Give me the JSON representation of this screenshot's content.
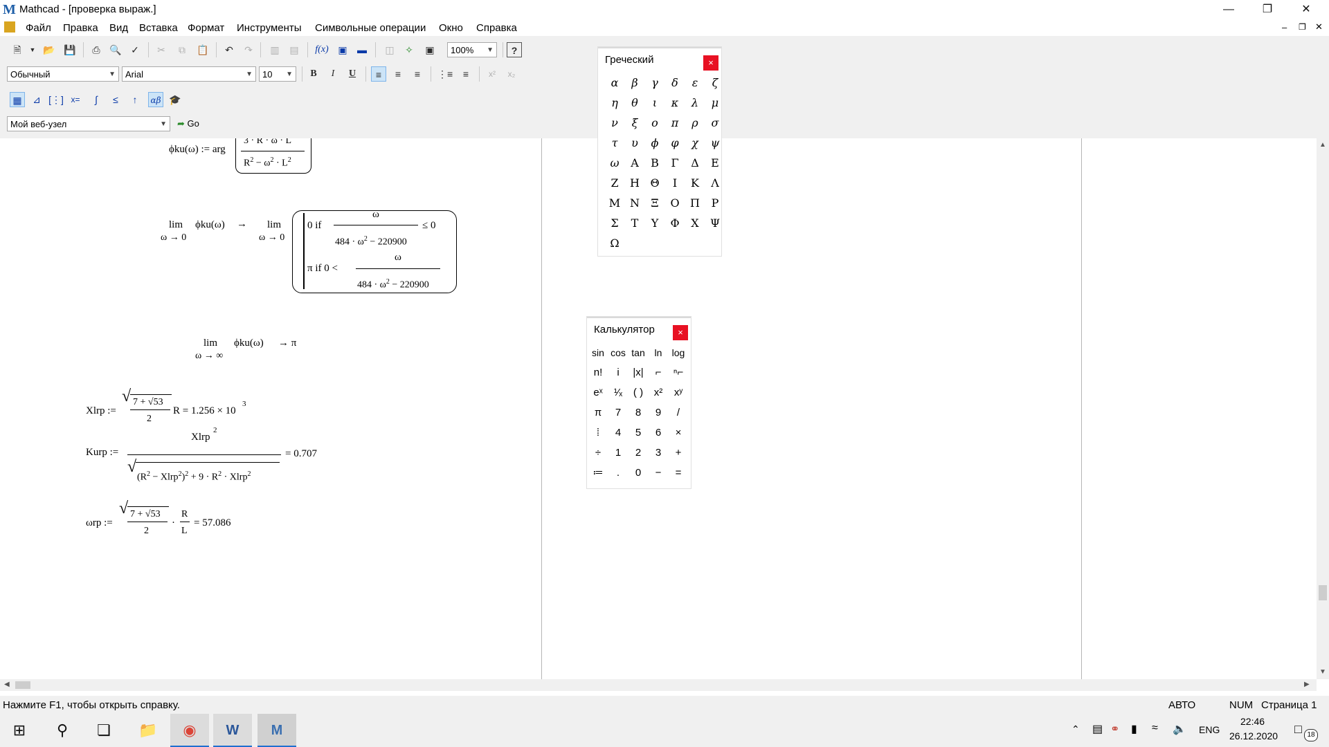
{
  "titlebar": {
    "app_title": "Mathcad - [проверка выраж.]",
    "logo": "mathcad-logo"
  },
  "menu": {
    "items": [
      "Файл",
      "Правка",
      "Вид",
      "Вставка",
      "Формат",
      "Инструменты",
      "Символьные операции",
      "Окно",
      "Справка"
    ]
  },
  "toolbar": {
    "zoom": "100%",
    "style": "Обычный",
    "font": "Arial",
    "size": "10",
    "bold": "B",
    "italic": "I",
    "underline": "U",
    "url": "Мой веб-узел",
    "go": "Go"
  },
  "document": {
    "phi_def": {
      "lhs": "ϕku(ω) := arg",
      "num": "3 · R · ω · L",
      "den": "R",
      "den_mid": " − ω",
      "den_end": " · L",
      "exp": "2"
    },
    "lim0": {
      "lim": "lim",
      "sub": "ω → 0",
      "func": "ϕku(ω)",
      "arrow": "→",
      "branch1_prefix": "0  if",
      "branch1_num": "ω",
      "branch1_den": "484 · ω",
      "branch1_den_tail": " − 220900",
      "branch1_cmp": "≤ 0",
      "branch2_prefix": "π  if  0 <",
      "branch2_num": "ω",
      "branch2_den": "484 · ω",
      "branch2_den_tail": " − 220900",
      "exp": "2"
    },
    "liminf": {
      "lim": "lim",
      "sub": "ω → ∞",
      "func": "ϕku(ω)",
      "result": "→  π"
    },
    "xlrp": {
      "lhs": "Xlrp :=",
      "num": "7 + √53",
      "den": "2",
      "tail": "R = 1.256 × 10",
      "exp": "3"
    },
    "kurp": {
      "lhs": "Kurp :=",
      "num": "Xlrp",
      "num_exp": "2",
      "den_a": "(R",
      "den_b": " − Xlrp",
      "den_c": ")",
      "den_d": " + 9 · R",
      "den_e": " · Xlrp",
      "exp": "2",
      "result": "= 0.707"
    },
    "wrp": {
      "lhs": "ωrp :=",
      "num": "7 + √53",
      "den": "2",
      "mid": "·",
      "num2": "R",
      "den2": "L",
      "result": "= 57.086"
    }
  },
  "greek_palette": {
    "title": "Греческий",
    "close": "×",
    "rows": [
      [
        "α",
        "β",
        "γ",
        "δ",
        "ε",
        "ζ"
      ],
      [
        "η",
        "θ",
        "ι",
        "κ",
        "λ",
        "μ"
      ],
      [
        "ν",
        "ξ",
        "ο",
        "π",
        "ρ",
        "σ"
      ],
      [
        "τ",
        "υ",
        "ϕ",
        "φ",
        "χ",
        "ψ"
      ],
      [
        "ω",
        "Α",
        "Β",
        "Γ",
        "Δ",
        "Ε"
      ],
      [
        "Ζ",
        "Η",
        "Θ",
        "Ι",
        "Κ",
        "Λ"
      ],
      [
        "Μ",
        "Ν",
        "Ξ",
        "Ο",
        "Π",
        "Ρ"
      ],
      [
        "Σ",
        "Τ",
        "Υ",
        "Φ",
        "Χ",
        "Ψ"
      ],
      [
        "Ω"
      ]
    ]
  },
  "calc_palette": {
    "title": "Калькулятор",
    "close": "×",
    "rows": [
      [
        "sin",
        "cos",
        "tan",
        "ln",
        "log"
      ],
      [
        "n!",
        "i",
        "|x|",
        "⌐",
        "ⁿ⌐"
      ],
      [
        "eˣ",
        "¹⁄ₓ",
        "( )",
        "x²",
        "xʸ"
      ],
      [
        "π",
        "7",
        "8",
        "9",
        "/"
      ],
      [
        "⁞",
        "4",
        "5",
        "6",
        "×"
      ],
      [
        "÷",
        "1",
        "2",
        "3",
        "+"
      ],
      [
        "≔",
        ".",
        "0",
        "−",
        "="
      ]
    ]
  },
  "statusbar": {
    "help": "Нажмите F1, чтобы открыть справку.",
    "mode": "АВТО",
    "num": "NUM",
    "page": "Страница 1"
  },
  "taskbar": {
    "lang": "ENG",
    "time": "22:46",
    "date": "26.12.2020",
    "notif_count": "18"
  }
}
